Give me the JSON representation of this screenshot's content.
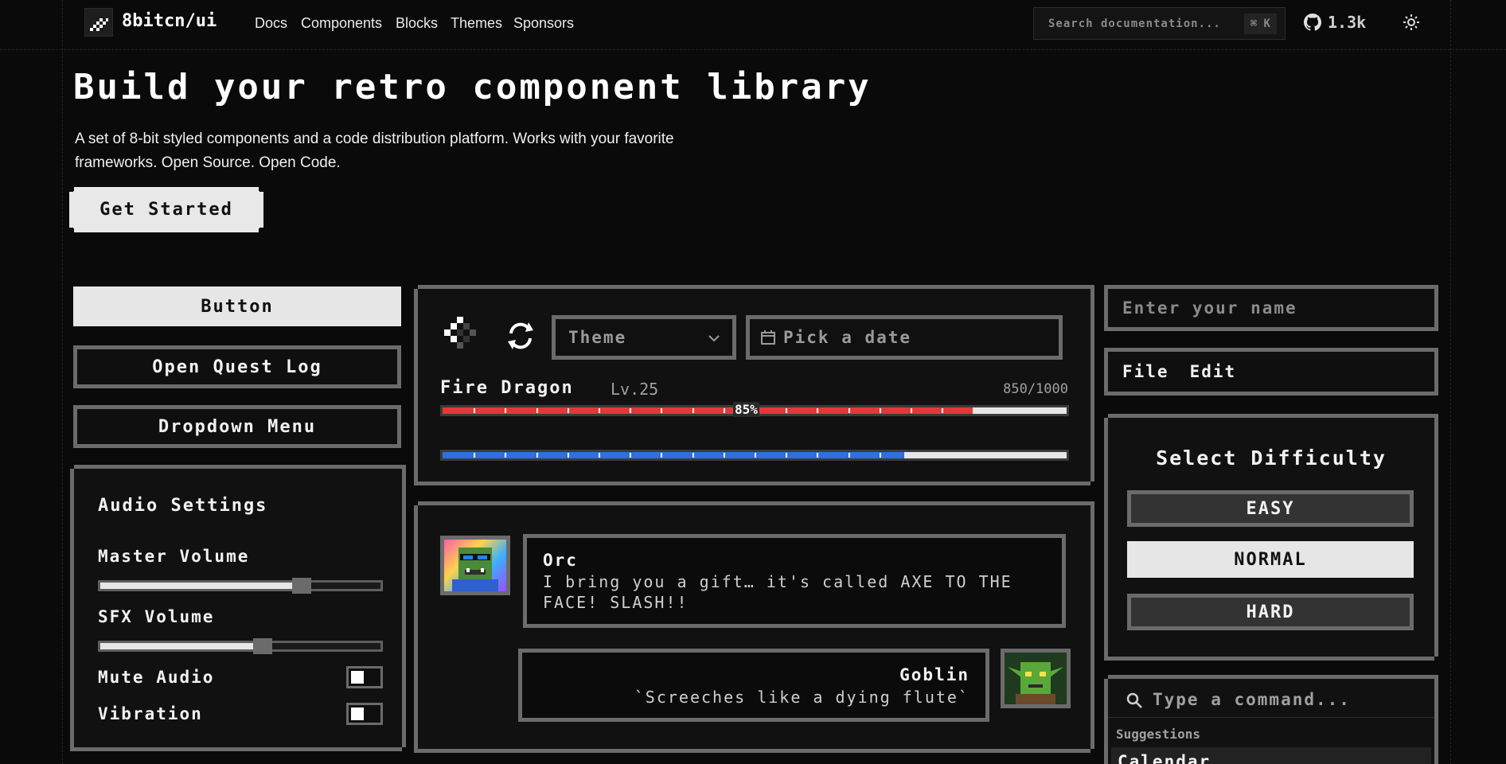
{
  "nav": {
    "brand": "8bitcn/ui",
    "links": [
      "Docs",
      "Components",
      "Blocks",
      "Themes",
      "Sponsors"
    ],
    "search_placeholder": "Search documentation...",
    "search_shortcut": "⌘ K",
    "github_stars": "1.3k"
  },
  "hero": {
    "title": "Build your retro component library",
    "description": "A set of 8-bit styled components and a code distribution platform. Works with your favorite frameworks. Open Source. Open Code.",
    "cta": "Get Started"
  },
  "left": {
    "button": "Button",
    "quest": "Open Quest Log",
    "dropdown": "Dropdown Menu",
    "audio_title": "Audio Settings",
    "master_label": "Master Volume",
    "master_value": 0.72,
    "sfx_label": "SFX Volume",
    "sfx_value": 0.58,
    "mute_label": "Mute Audio",
    "vibration_label": "Vibration"
  },
  "middle": {
    "theme_select": "Theme",
    "date_placeholder": "Pick a date",
    "enemy_name": "Fire Dragon",
    "enemy_level": "Lv.25",
    "enemy_hp": "850/1000",
    "hp_percent_label": "85%",
    "hp_fraction": 0.85,
    "mana_fraction": 0.74,
    "chat": [
      {
        "speaker": "Orc",
        "text": "I bring you a gift… it's called AXE TO THE FACE! SLASH!!"
      },
      {
        "speaker": "Goblin",
        "text": "`Screeches like a dying flute`"
      }
    ]
  },
  "right": {
    "name_placeholder": "Enter your name",
    "menubar": [
      "File",
      "Edit"
    ],
    "difficulty_title": "Select Difficulty",
    "difficulties": [
      "EASY",
      "NORMAL",
      "HARD"
    ],
    "selected_difficulty": "NORMAL",
    "command_placeholder": "Type a command...",
    "suggestions_label": "Suggestions",
    "first_suggestion": "Calendar"
  },
  "colors": {
    "hp_bar": "#e5373b",
    "mana_bar": "#2f6fe0",
    "frame": "#6b6b6b",
    "background": "#0a0a0a"
  }
}
